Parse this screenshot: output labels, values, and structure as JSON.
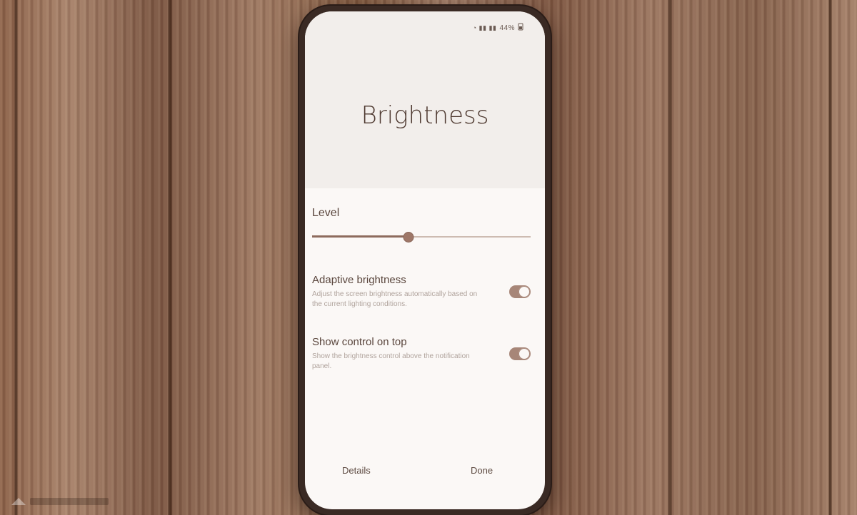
{
  "status_bar": {
    "icons": "◔ ▮▮ ▮▮",
    "battery_text": "44%",
    "battery_icon": "battery-icon"
  },
  "screen": {
    "title": "Brightness",
    "level": {
      "label": "Level",
      "value_fraction": 0.44
    },
    "settings": [
      {
        "title": "Adaptive brightness",
        "description": "Adjust the screen brightness automatically based on the current lighting conditions.",
        "enabled": true
      },
      {
        "title": "Show control on top",
        "description": "Show the brightness control above the notification panel.",
        "enabled": true
      }
    ],
    "actions": {
      "details": "Details",
      "done": "Done"
    }
  },
  "colors": {
    "accent": "#a78678",
    "title_text": "#4f3a31",
    "screen_bg": "#fbf8f6",
    "wood": "#8b6149"
  }
}
